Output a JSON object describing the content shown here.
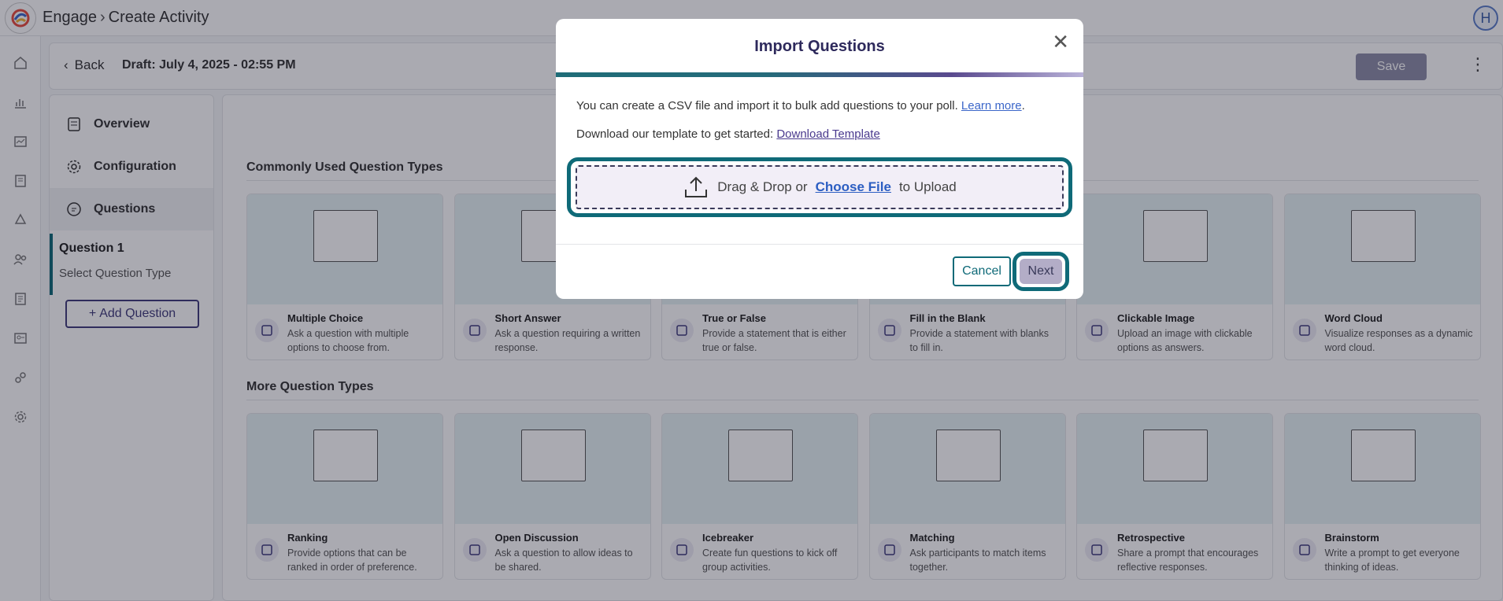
{
  "app": {
    "name": "Engage",
    "page": "Create Activity",
    "avatar": "H"
  },
  "header": {
    "back": "Back",
    "draft": "Draft: July 4, 2025 - 02:55 PM",
    "save": "Save"
  },
  "nav": {
    "overview": "Overview",
    "configuration": "Configuration",
    "questions": "Questions",
    "question1": "Question 1",
    "question1_sub": "Select Question Type",
    "add_question": "Add Question"
  },
  "sections": {
    "common": "Commonly Used Question Types",
    "more": "More Question Types"
  },
  "common_types": [
    {
      "title": "Multiple Choice",
      "desc": "Ask a question with multiple options to choose from."
    },
    {
      "title": "Short Answer",
      "desc": "Ask a question requiring a written response."
    },
    {
      "title": "True or False",
      "desc": "Provide a statement that is either true or false."
    },
    {
      "title": "Fill in the Blank",
      "desc": "Provide a statement with blanks to fill in."
    },
    {
      "title": "Clickable Image",
      "desc": "Upload an image with clickable options as answers."
    },
    {
      "title": "Word Cloud",
      "desc": "Visualize responses as a dynamic word cloud."
    }
  ],
  "more_types": [
    {
      "title": "Ranking",
      "desc": "Provide options that can be ranked in order of preference."
    },
    {
      "title": "Open Discussion",
      "desc": "Ask a question to allow ideas to be shared."
    },
    {
      "title": "Icebreaker",
      "desc": "Create fun questions to kick off group activities."
    },
    {
      "title": "Matching",
      "desc": "Ask participants to match items together."
    },
    {
      "title": "Retrospective",
      "desc": "Share a prompt that encourages reflective responses."
    },
    {
      "title": "Brainstorm",
      "desc": "Write a prompt to get everyone thinking of ideas."
    }
  ],
  "modal": {
    "title": "Import Questions",
    "line1": "You can create a CSV file and import it to bulk add questions to your poll.",
    "learn_more": "Learn more",
    "line1_end": ".",
    "line2": "Download our template to get started:",
    "download": "Download Template",
    "drop_prefix": "Drag & Drop or",
    "choose_file": "Choose File",
    "drop_suffix": "to Upload",
    "cancel": "Cancel",
    "next": "Next"
  },
  "colors": {
    "accent": "#0f6a78",
    "brand": "#3f3a7a",
    "link": "#3b66c9"
  }
}
